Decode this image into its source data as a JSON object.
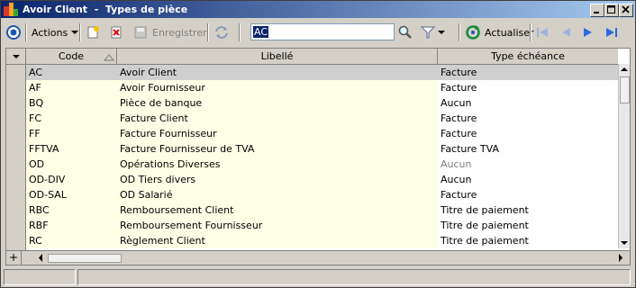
{
  "window": {
    "title": "Avoir Client  -  Types de pièce",
    "controls": [
      "minimize",
      "maximize",
      "close"
    ]
  },
  "toolbar": {
    "actions_label": "Actions",
    "save_label": "Enregistrer",
    "search_value": "AC",
    "refresh_label": "Actualiser",
    "icons": [
      "circle-menu-icon",
      "new-record-icon",
      "delete-icon",
      "save-icon",
      "sync-icon",
      "search-icon",
      "filter-icon",
      "refresh-icon",
      "first-icon",
      "previous-icon",
      "next-icon",
      "last-icon"
    ]
  },
  "table": {
    "columns": [
      "Code",
      "Libellé",
      "Type échéance"
    ],
    "sort_column": "Code",
    "rows": [
      {
        "code": "AC",
        "libelle": "Avoir Client",
        "type": "Facture"
      },
      {
        "code": "AF",
        "libelle": "Avoir Fournisseur",
        "type": "Facture"
      },
      {
        "code": "BQ",
        "libelle": "Pièce de banque",
        "type": "Aucun"
      },
      {
        "code": "FC",
        "libelle": "Facture Client",
        "type": "Facture"
      },
      {
        "code": "FF",
        "libelle": "Facture Fournisseur",
        "type": "Facture"
      },
      {
        "code": "FFTVA",
        "libelle": "Facture Fournisseur de TVA",
        "type": "Facture TVA"
      },
      {
        "code": "OD",
        "libelle": "Opérations Diverses",
        "type": "Aucun"
      },
      {
        "code": "OD-DIV",
        "libelle": "OD Tiers divers",
        "type": "Aucun"
      },
      {
        "code": "OD-SAL",
        "libelle": "OD Salarié",
        "type": "Facture"
      },
      {
        "code": "RBC",
        "libelle": "Remboursement Client",
        "type": "Titre de paiement"
      },
      {
        "code": "RBF",
        "libelle": "Remboursement Fournisseur",
        "type": "Titre de paiement"
      },
      {
        "code": "RC",
        "libelle": "Règlement Client",
        "type": "Titre de paiement"
      }
    ],
    "selected_row": "AC",
    "greyed_type_row": "OD",
    "colors": {
      "odd_row": "#ffffe6",
      "selected_row": "#cfcfcf",
      "greyed_text": "#808080"
    }
  }
}
